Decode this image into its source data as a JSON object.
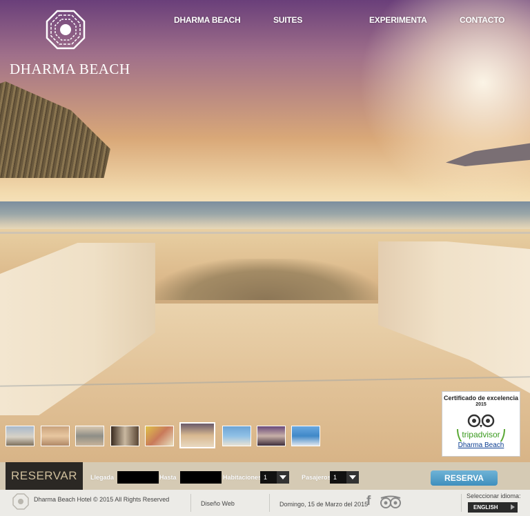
{
  "brand": {
    "name": "DHARMA BEACH"
  },
  "nav": [
    {
      "label": "DHARMA BEACH"
    },
    {
      "label": "SUITES"
    },
    {
      "label": "EXPERIMENTA"
    },
    {
      "label": "CONTACTO"
    }
  ],
  "thumbnails": {
    "count": 9,
    "active_index": 5
  },
  "tripadvisor": {
    "title": "Certificado de excelencia",
    "year": "2015",
    "brand": "tripadvisor",
    "hotel": "Dharma Beach"
  },
  "booking": {
    "reservar": "RESERVAR",
    "arrival_label": "Llegada",
    "until_label": "Hasta",
    "rooms_label": "Habitaciones",
    "rooms_value": "1",
    "guests_label": "Pasajeros",
    "guests_value": "1",
    "submit": "RESERVA"
  },
  "footer": {
    "copyright": "Dharma Beach Hotel © 2015 All Rights Reserved",
    "design": "Diseño Web",
    "date": "Domingo, 15 de Marzo del 2015",
    "facebook": "f",
    "language_label": "Seleccionar idioma:",
    "language_value": "ENGLISH"
  },
  "colors": {
    "booking_bar": "#d5cab4",
    "reservar_bg": "#2b2824",
    "reserva_button": "#3f8fbd",
    "footer_bg": "#ecebe7"
  }
}
